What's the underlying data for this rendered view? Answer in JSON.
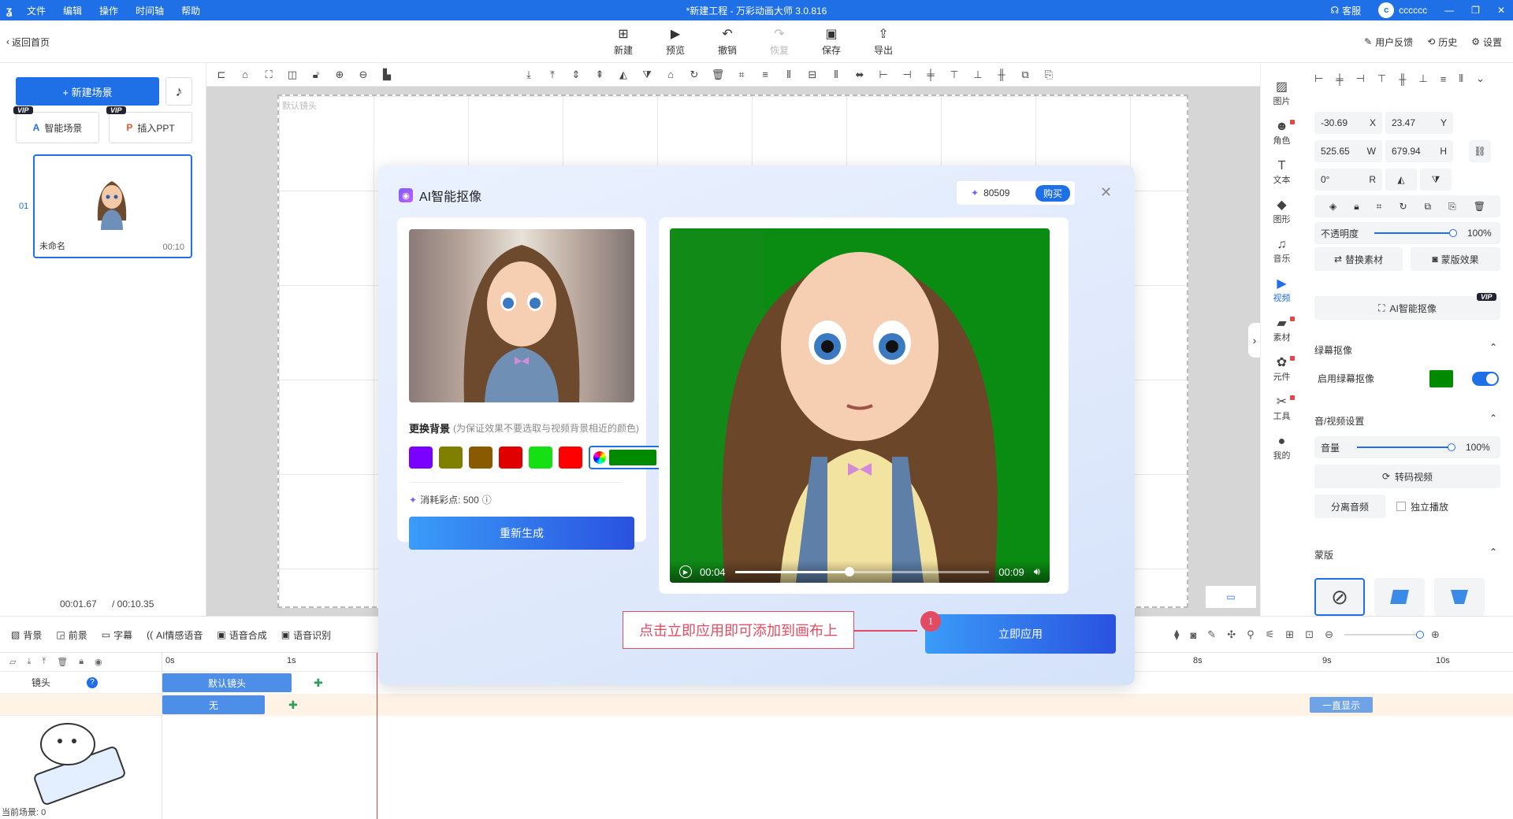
{
  "window": {
    "title": "*新建工程 - 万彩动画大师 3.0.816",
    "menu": [
      "文件",
      "编辑",
      "操作",
      "时间轴",
      "帮助"
    ],
    "support": "客服",
    "username": "cccccc",
    "avatar_letter": "c"
  },
  "toolbar": {
    "back_label": "返回首页",
    "buttons": [
      {
        "label": "新建",
        "icon": "new-icon"
      },
      {
        "label": "预览",
        "icon": "play-icon"
      },
      {
        "label": "撤销",
        "icon": "undo-icon"
      },
      {
        "label": "恢复",
        "icon": "redo-icon",
        "disabled": true
      },
      {
        "label": "保存",
        "icon": "save-icon"
      },
      {
        "label": "导出",
        "icon": "export-icon"
      }
    ],
    "feedback_label": "用户反馈",
    "history_label": "历史",
    "settings_label": "设置"
  },
  "left": {
    "new_scene": "+ 新建场景",
    "smart_scene": "智能场景",
    "insert_ppt": "插入PPT",
    "vip": "VIP",
    "scene": {
      "index": "01",
      "name": "未命名",
      "duration": "00:10"
    },
    "time_current": "00:01.67",
    "time_total": "/ 00:10.35"
  },
  "canvas": {
    "camera_label": "默认镜头"
  },
  "icon_column": [
    {
      "label": "图片",
      "icon": "image-icon"
    },
    {
      "label": "角色",
      "icon": "person-icon",
      "dot": true
    },
    {
      "label": "文本",
      "icon": "text-icon"
    },
    {
      "label": "图形",
      "icon": "shape-icon"
    },
    {
      "label": "音乐",
      "icon": "music-icon"
    },
    {
      "label": "视频",
      "icon": "video-icon",
      "active": true
    },
    {
      "label": "素材",
      "icon": "material-icon",
      "dot": true
    },
    {
      "label": "元件",
      "icon": "component-icon",
      "dot": true
    },
    {
      "label": "工具",
      "icon": "tool-icon",
      "dot": true
    },
    {
      "label": "我的",
      "icon": "user-icon"
    }
  ],
  "props": {
    "x": "-30.69",
    "x_label": "X",
    "y": "23.47",
    "y_label": "Y",
    "w": "525.65",
    "w_label": "W",
    "h": "679.94",
    "h_label": "H",
    "r": "0°",
    "r_label": "R",
    "opacity_label": "不透明度",
    "opacity": "100%",
    "replace_label": "替换素材",
    "mask_effect_label": "蒙版效果",
    "ai_matting_label": "AI智能抠像",
    "vip": "VIP",
    "green_section": "绿幕抠像",
    "enable_green": "启用绿幕抠像",
    "green_color": "#008a00",
    "av_section": "音/视频设置",
    "volume_label": "音量",
    "volume": "100%",
    "transcode_label": "转码视频",
    "split_audio_label": "分离音频",
    "solo_label": "独立播放",
    "mask_section": "蒙版"
  },
  "timeline": {
    "tabs": [
      "背景",
      "前景",
      "字幕",
      "AI情感语音",
      "语音合成",
      "语音识别"
    ],
    "ruler": [
      "0s",
      "1s",
      "8s",
      "9s",
      "10s"
    ],
    "track1_label": "镜头",
    "clip1": "默认镜头",
    "clip2": "无",
    "clip3": "一直显示",
    "current_scene": "当前场景: 0"
  },
  "modal": {
    "title": "AI智能抠像",
    "points": "80509",
    "buy": "购买",
    "replace_bg_label": "更换背景",
    "replace_bg_hint": "(为保证效果不要选取与视频背景相近的颜色)",
    "swatches": [
      "#7a00ff",
      "#808000",
      "#8a5a00",
      "#e00000",
      "#14e014",
      "#ff0000"
    ],
    "selected_color": "#008a00",
    "cost_label": "消耗彩点: 500",
    "regenerate": "重新生成",
    "time_current": "00:04",
    "time_total": "00:09",
    "progress": 0.45,
    "apply": "立即应用",
    "callout": "点击立即应用即可添加到画布上",
    "step": "1"
  }
}
